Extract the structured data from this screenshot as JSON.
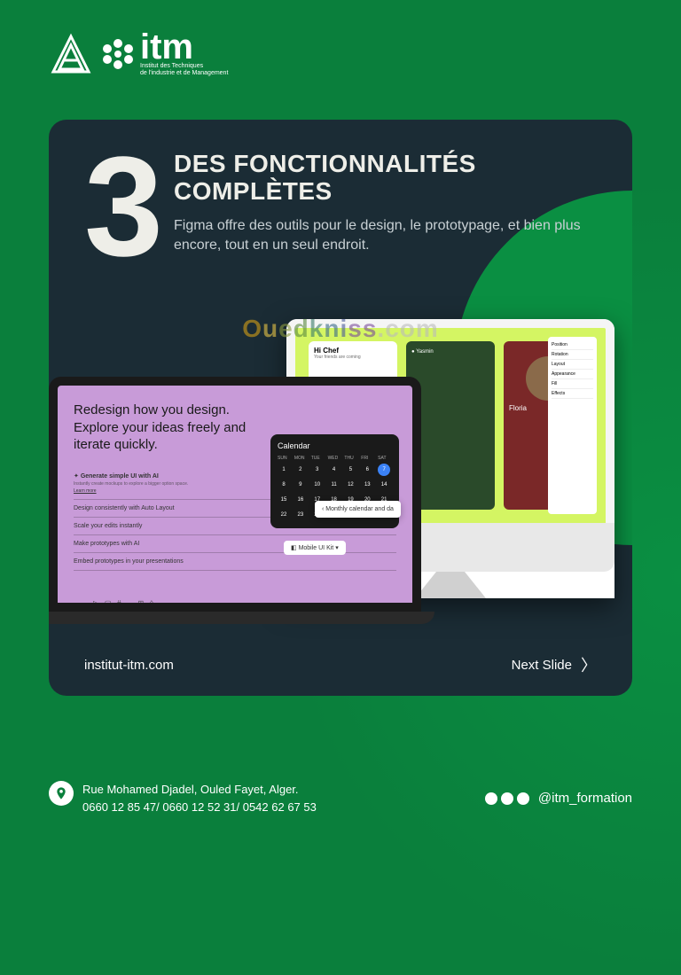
{
  "logo": {
    "brand": "itm",
    "subtitle1": "Institut des Techniques",
    "subtitle2": "de l'industrie et de Management"
  },
  "hero": {
    "number": "3",
    "title_line1": "DES FONCTIONNALITÉS",
    "title_line2": "COMPLÈTES",
    "description": "Figma offre des outils pour le design, le prototypage, et bien plus encore, tout en un seul endroit."
  },
  "laptop": {
    "title_line1": "Redesign how you design.",
    "title_line2": "Explore your ideas freely and",
    "title_line3": "iterate quickly.",
    "items": [
      {
        "h": "Generate simple UI with AI",
        "s": "Instantly create mockups to explore a bigger option space.",
        "l": "Learn more"
      },
      {
        "h": "Design consistently with Auto Layout"
      },
      {
        "h": "Scale your edits instantly"
      },
      {
        "h": "Make prototypes with AI"
      },
      {
        "h": "Embed prototypes in your presentations"
      }
    ],
    "calendar": {
      "title": "Calendar",
      "days": [
        "SUN",
        "MON",
        "TUE",
        "WED",
        "THU",
        "FRI",
        "SAT"
      ],
      "popup": "Monthly calendar and da",
      "kit": "Mobile UI Kit"
    }
  },
  "imac": {
    "cards": [
      {
        "title": "Hi Chef",
        "sub": "Your friends are coming"
      },
      {
        "title": "Yasmin"
      },
      {
        "title": "Floria"
      }
    ],
    "sidebar": [
      "Position",
      "Rotation",
      "Layout",
      "Appearance",
      "Fill",
      "Effects"
    ]
  },
  "watermark_letters": [
    "O",
    "u",
    "e",
    "d",
    "k",
    "n",
    "i",
    "s",
    "s",
    ".",
    "c",
    "o",
    "m"
  ],
  "card_footer": {
    "website": "institut-itm.com",
    "next": "Next Slide"
  },
  "footer": {
    "address": "Rue Mohamed Djadel, Ouled Fayet, Alger.",
    "phones": "0660 12 85 47/ 0660 12 52 31/ 0542 62 67 53",
    "handle": "@itm_formation"
  }
}
